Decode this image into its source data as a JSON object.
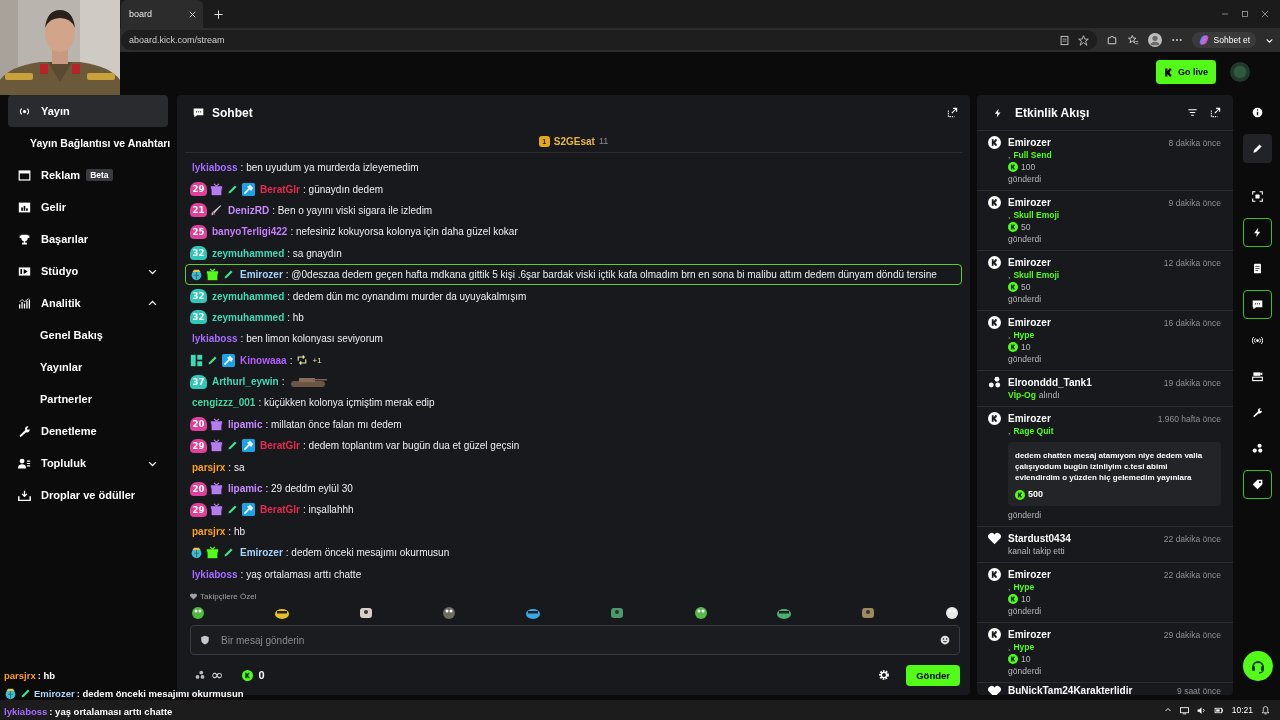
{
  "browser": {
    "tab_title": "board",
    "url": "aboard.kick.com/stream",
    "copilot_label": "Sohbet et"
  },
  "header": {
    "go_live": "Go live"
  },
  "sidebar": {
    "items": [
      {
        "label": "Yayın",
        "kind": "stream",
        "selected": true
      },
      {
        "label": "Yayın Bağlantısı ve Anahtarı",
        "kind": "sub",
        "selected": false
      },
      {
        "label": "Reklam",
        "kind": "ads",
        "badge": "Beta",
        "selected": false
      },
      {
        "label": "Gelir",
        "kind": "revenue",
        "selected": false
      },
      {
        "label": "Başarılar",
        "kind": "trophy",
        "selected": false
      },
      {
        "label": "Stüdyo",
        "kind": "studio",
        "selected": false,
        "expanded": false
      },
      {
        "label": "Analitik",
        "kind": "analytics",
        "selected": false,
        "expanded": true,
        "children": [
          {
            "label": "Genel Bakış",
            "selected": false
          },
          {
            "label": "Yayınlar",
            "selected": false
          },
          {
            "label": "Partnerler",
            "selected": false
          }
        ]
      },
      {
        "label": "Denetleme",
        "kind": "moderation",
        "selected": false
      },
      {
        "label": "Topluluk",
        "kind": "community",
        "selected": false,
        "expanded": false
      },
      {
        "label": "Droplar ve ödüller",
        "kind": "drops",
        "selected": false
      }
    ]
  },
  "chat": {
    "title": "Sohbet",
    "pinned": {
      "rank": "1",
      "user": "S2GEsat",
      "count": "11"
    },
    "messages": [
      {
        "kind": "text",
        "user": "lykiaboss",
        "color": "#a66bff",
        "text": ": ben uyudum ya murderda izleyemedim",
        "highlighted": false
      },
      {
        "badges": [
          {
            "kind": "sub",
            "label": "29",
            "color": "#e0409a"
          },
          {
            "kind": "gift",
            "color": "#b67cf0"
          },
          {
            "kind": "pen"
          },
          {
            "kind": "mod"
          }
        ],
        "user": "BeratGlr",
        "color": "#e8284e",
        "text": ": günaydın dedem",
        "highlighted": false
      },
      {
        "badges": [
          {
            "kind": "sub",
            "label": "21",
            "color": "#e0409a"
          },
          {
            "kind": "sword"
          }
        ],
        "user": "DenizRD",
        "color": "#c58bff",
        "text": ": Ben o yayını viski sigara ile izledim",
        "highlighted": false
      },
      {
        "badges": [
          {
            "kind": "sub",
            "label": "25",
            "color": "#e0409a"
          }
        ],
        "user": "banyoTerligi422",
        "color": "#c77dff",
        "text": ": nefesiniz kokuyorsa kolonya için daha güzel kokar",
        "highlighted": false
      },
      {
        "badges": [
          {
            "kind": "sub",
            "label": "32",
            "color": "#2fc7b8"
          }
        ],
        "user": "zeymuhammed",
        "color": "#3fd9b5",
        "text": ": sa gnaydın",
        "highlighted": false
      },
      {
        "badges": [
          {
            "kind": "og"
          },
          {
            "kind": "gift",
            "color": "#53fc18"
          },
          {
            "kind": "pen"
          }
        ],
        "user": "Emirozer",
        "color": "#a9d4ff",
        "text": ": @0deszaa dedem geçen hafta mdkana gittik 5 kişi .6şar bardak viski içtik kafa olmadım brn en sona bi malibu attım dedem dünyam döndü tersine",
        "highlighted": true
      },
      {
        "badges": [
          {
            "kind": "sub",
            "label": "32",
            "color": "#2fc7b8"
          }
        ],
        "user": "zeymuhammed",
        "color": "#3fd9b5",
        "text": ": dedem dün mc oynandımı murder da uyuyakalmışım",
        "highlighted": false
      },
      {
        "badges": [
          {
            "kind": "sub",
            "label": "32",
            "color": "#2fc7b8"
          }
        ],
        "user": "zeymuhammed",
        "color": "#3fd9b5",
        "text": ": hb",
        "highlighted": false
      },
      {
        "kind": "text",
        "user": "lykiaboss",
        "color": "#a66bff",
        "text": ": ben limon kolonyası seviyorum",
        "highlighted": false
      },
      {
        "kind": "loop",
        "badges": [
          {
            "kind": "grid"
          },
          {
            "kind": "pen"
          },
          {
            "kind": "mod"
          }
        ],
        "user": "Kinowaaa",
        "color": "#b45cff",
        "text": ":",
        "suffix": "+1",
        "highlighted": false
      },
      {
        "kind": "tank",
        "badges": [
          {
            "kind": "sub",
            "label": "37",
            "color": "#2fc7b8"
          }
        ],
        "user": "Arthurl_eywin",
        "color": "#3fd9b5",
        "text": ":",
        "highlighted": false
      },
      {
        "kind": "text",
        "user": "cengizzz_001",
        "color": "#3fd9a0",
        "text": ": küçükken kolonya içmiştim merak edip",
        "highlighted": false
      },
      {
        "badges": [
          {
            "kind": "sub",
            "label": "20",
            "color": "#e0409a"
          },
          {
            "kind": "gift",
            "color": "#b67cf0"
          }
        ],
        "user": "lipamic",
        "color": "#c58bff",
        "text": ": millatan önce falan mı dedem",
        "highlighted": false
      },
      {
        "badges": [
          {
            "kind": "sub",
            "label": "29",
            "color": "#e0409a"
          },
          {
            "kind": "gift",
            "color": "#b67cf0"
          },
          {
            "kind": "pen"
          },
          {
            "kind": "mod"
          }
        ],
        "user": "BeratGlr",
        "color": "#e8284e",
        "text": ": dedem toplantım var bugün dua et güzel geçsin",
        "highlighted": false
      },
      {
        "kind": "text",
        "user": "parsjrx",
        "color": "#ff9f1a",
        "text": ": sa",
        "highlighted": false
      },
      {
        "badges": [
          {
            "kind": "sub",
            "label": "20",
            "color": "#e0409a"
          },
          {
            "kind": "gift",
            "color": "#b67cf0"
          }
        ],
        "user": "lipamic",
        "color": "#c58bff",
        "text": ": 29 deddm eylül 30",
        "highlighted": false
      },
      {
        "badges": [
          {
            "kind": "sub",
            "label": "29",
            "color": "#e0409a"
          },
          {
            "kind": "gift",
            "color": "#b67cf0"
          },
          {
            "kind": "pen"
          },
          {
            "kind": "mod"
          }
        ],
        "user": "BeratGlr",
        "color": "#e8284e",
        "text": ": inşallahhh",
        "highlighted": false
      },
      {
        "kind": "text",
        "user": "parsjrx",
        "color": "#ff9f1a",
        "text": ": hb",
        "highlighted": false
      },
      {
        "badges": [
          {
            "kind": "og"
          },
          {
            "kind": "gift",
            "color": "#53fc18"
          },
          {
            "kind": "pen"
          }
        ],
        "user": "Emirozer",
        "color": "#a9d4ff",
        "text": ": dedem önceki mesajımı okurmusun",
        "highlighted": false
      },
      {
        "kind": "text",
        "user": "lykiaboss",
        "color": "#a66bff",
        "text": ": yaş ortalaması arttı chatte",
        "highlighted": false
      }
    ],
    "emote_section": "Takipçilere Özel",
    "placeholder": "Bir mesaj gönderin",
    "infinity": "∞",
    "points": "0",
    "send": "Gönder"
  },
  "events": {
    "title": "Etkinlik Akışı",
    "items": [
      {
        "kind": "kick",
        "user": "Emirozer",
        "time": "8 dakika önce",
        "lead": ",",
        "item": "Full Send",
        "amount": "100",
        "action": "gönderdi"
      },
      {
        "kind": "kick",
        "user": "Emirozer",
        "time": "9 dakika önce",
        "lead": ",",
        "item": "Skull Emoji",
        "amount": "50",
        "action": "gönderdi"
      },
      {
        "kind": "kick",
        "user": "Emirozer",
        "time": "12 dakika önce",
        "lead": ",",
        "item": "Skull Emoji",
        "amount": "50",
        "action": "gönderdi"
      },
      {
        "kind": "kick",
        "user": "Emirozer",
        "time": "16 dakika önce",
        "lead": ",",
        "item": "Hype",
        "amount": "10",
        "action": "gönderdi"
      },
      {
        "kind": "vip",
        "user": "Elroonddd_Tank1",
        "time": "19 dakika önce",
        "item": "Vİp-Og",
        "action": "alındı"
      },
      {
        "kind": "kick",
        "user": "Emirozer",
        "time": "1.960 hafta önce",
        "lead": ",",
        "item": "Rage Quit",
        "message": "dedem chatten mesaj atamıyom niye dedem valla çalışıyodum bugün izinliyim c.tesi abimi evlendirdim o yüzden hiç gelemedim yayınlara",
        "amount": "500",
        "action": "gönderdi"
      },
      {
        "kind": "follow",
        "user": "Stardust0434",
        "time": "22 dakika önce",
        "action": "kanalı takip etti"
      },
      {
        "kind": "kick",
        "user": "Emirozer",
        "time": "22 dakika önce",
        "lead": ",",
        "item": "Hype",
        "amount": "10",
        "action": "gönderdi"
      },
      {
        "kind": "kick",
        "user": "Emirozer",
        "time": "29 dakika önce",
        "lead": ",",
        "item": "Hype",
        "amount": "10",
        "action": "gönderdi"
      },
      {
        "kind": "follow",
        "user": "BuNickTam24Karakterlidir",
        "time": "9 saat önce"
      }
    ]
  },
  "rail": [
    {
      "kind": "info",
      "selected": false
    },
    {
      "kind": "edit",
      "selected": false
    },
    {
      "kind": "capture",
      "selected": false
    },
    {
      "kind": "events",
      "selected": true
    },
    {
      "kind": "notes",
      "selected": false
    },
    {
      "kind": "chat",
      "selected": true
    },
    {
      "kind": "broadcast",
      "selected": false
    },
    {
      "kind": "camera",
      "selected": false
    },
    {
      "kind": "tools",
      "selected": false
    },
    {
      "kind": "community",
      "selected": false
    },
    {
      "kind": "tag",
      "selected": true
    }
  ],
  "overlay": [
    {
      "user": "parsjrx",
      "color": "#ff9f1a",
      "text": " : hb"
    },
    {
      "badges": [
        {
          "kind": "og"
        },
        {
          "kind": "pen"
        }
      ],
      "user": "Emirozer",
      "color": "#a9d4ff",
      "text": " : dedem önceki mesajımı okurmusun"
    },
    {
      "user": "lykiaboss",
      "color": "#a66bff",
      "text": " : yaş ortalaması arttı chatte"
    }
  ],
  "taskbar": {
    "time": "10:21"
  }
}
